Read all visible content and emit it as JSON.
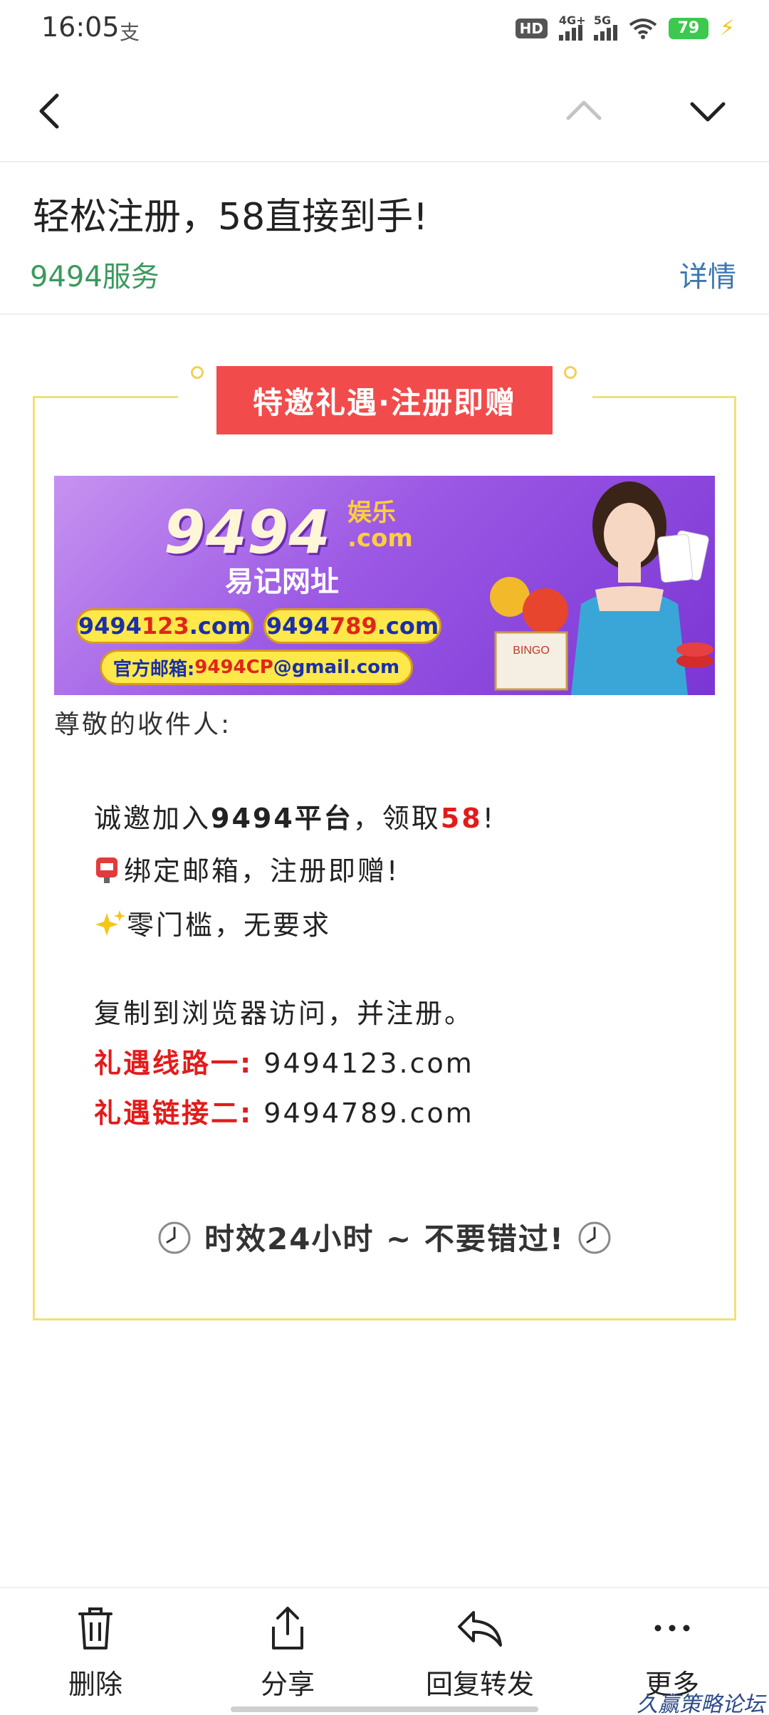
{
  "status_bar": {
    "time": "16:05",
    "alipay_icon": "支",
    "hd_badge": "HD",
    "net1": "4G+",
    "net2": "5G",
    "battery": "79"
  },
  "nav": {
    "back_icon": "chevron-left-icon",
    "prev_icon": "chevron-up-icon",
    "next_icon": "chevron-down-icon"
  },
  "email": {
    "subject": "轻松注册，58直接到手!",
    "sender": "9494服务",
    "details_label": "详情"
  },
  "card": {
    "title": "特邀礼遇·注册即赠"
  },
  "banner": {
    "logo": "9494",
    "brand_line1": "娱乐",
    "brand_line2": ".com",
    "subtitle": "易记网址",
    "pill1_prefix": "9494",
    "pill1_red": "123",
    "pill1_suffix": ".com",
    "pill2_prefix": "9494",
    "pill2_red": "789",
    "pill2_suffix": ".com",
    "mail_label": "官方邮箱:",
    "mail_red": "9494CP",
    "mail_suffix": "@gmail.com"
  },
  "body": {
    "greeting": "尊敬的收件人:",
    "invite_prefix": "诚邀加入",
    "invite_platform": "9494平台",
    "invite_mid": "，领取",
    "invite_amount": "58",
    "invite_end": "!",
    "bind_text": "绑定邮箱，注册即赠!",
    "zero_text": "零门槛，无要求",
    "copy_text": "复制到浏览器访问，并注册。",
    "link1_label": "礼遇线路一:",
    "link1_url": "9494123.com",
    "link2_label": "礼遇链接二:",
    "link2_url": "9494789.com",
    "footer": "时效24小时 ~ 不要错过!"
  },
  "toolbar": {
    "delete": "删除",
    "share": "分享",
    "reply_forward": "回复转发",
    "more": "更多"
  },
  "watermark": "久赢策略论坛",
  "colors": {
    "sender_green": "#3a9a5c",
    "link_blue": "#3a78b0",
    "title_red": "#f24b4b",
    "card_border": "#f2e07a",
    "emphasis_red": "#e31b1b"
  }
}
